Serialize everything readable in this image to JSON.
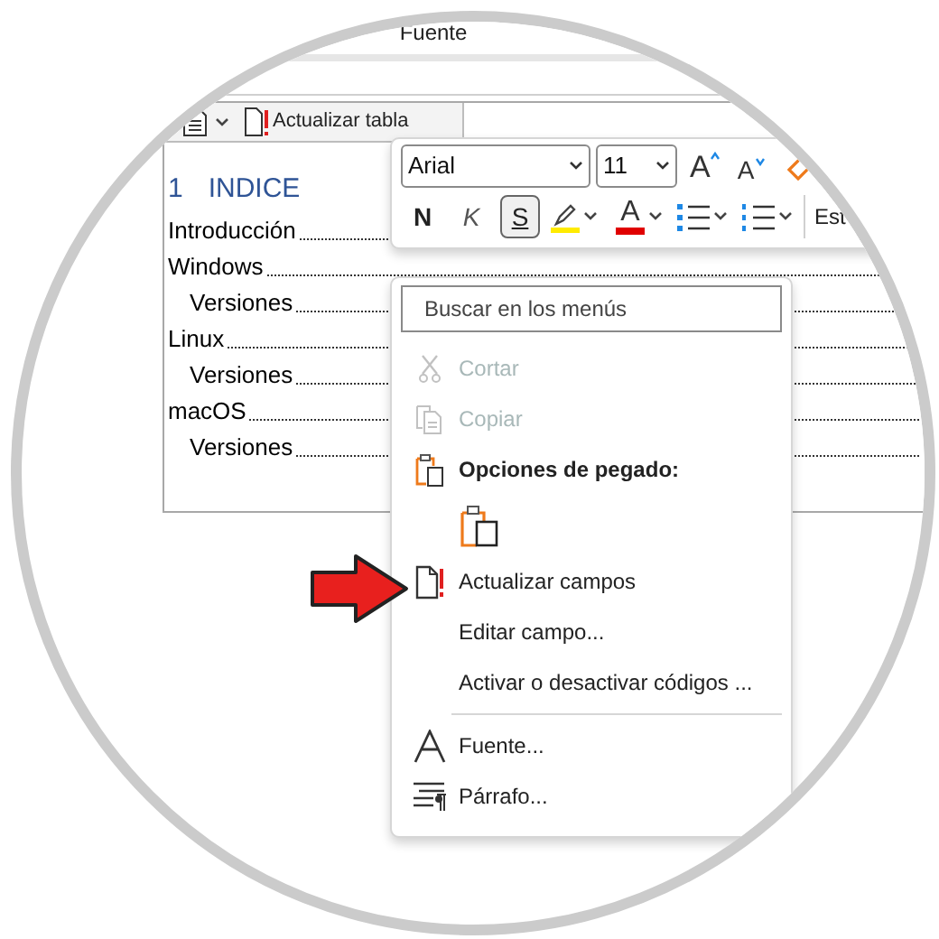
{
  "ribbon": {
    "group_label": "Fuente"
  },
  "doc_toolbar": {
    "update_button": "Actualizar tabla"
  },
  "document": {
    "heading_number": "1",
    "heading": "INDICE",
    "toc": [
      {
        "text": "Introducción"
      },
      {
        "text": "Windows",
        "children": [
          {
            "text": "Versiones"
          }
        ]
      },
      {
        "text": "Linux",
        "children": [
          {
            "text": "Versiones"
          }
        ]
      },
      {
        "text": "macOS",
        "children": [
          {
            "text": "Versiones"
          }
        ]
      }
    ]
  },
  "mini_toolbar": {
    "font": "Arial",
    "size": "11",
    "grow_label": "A",
    "shrink_label": "A",
    "styles_label": "Est",
    "format_buttons": [
      {
        "kind": "bold",
        "label": "N",
        "selected": false
      },
      {
        "kind": "italic",
        "label": "K",
        "selected": false
      },
      {
        "kind": "underline",
        "label": "S",
        "selected": true
      }
    ],
    "font_color_label": "A"
  },
  "context_menu": {
    "search_placeholder": "Buscar en los menús",
    "items": [
      {
        "kind": "cut",
        "label": "Cortar",
        "disabled": true
      },
      {
        "kind": "copy",
        "label": "Copiar",
        "disabled": true
      },
      {
        "kind": "paste_header",
        "label": "Opciones de pegado:",
        "disabled": false
      },
      {
        "kind": "paste_option"
      },
      {
        "kind": "update_fields",
        "label": "Actualizar campos",
        "disabled": false
      },
      {
        "kind": "edit_field",
        "label": "Editar campo...",
        "disabled": false
      },
      {
        "kind": "toggle_codes",
        "label": "Activar o desactivar códigos ...",
        "disabled": false
      },
      {
        "kind": "separator"
      },
      {
        "kind": "font",
        "label": "Fuente...",
        "disabled": false
      },
      {
        "kind": "paragraph",
        "label": "Párrafo...",
        "disabled": false
      }
    ]
  }
}
